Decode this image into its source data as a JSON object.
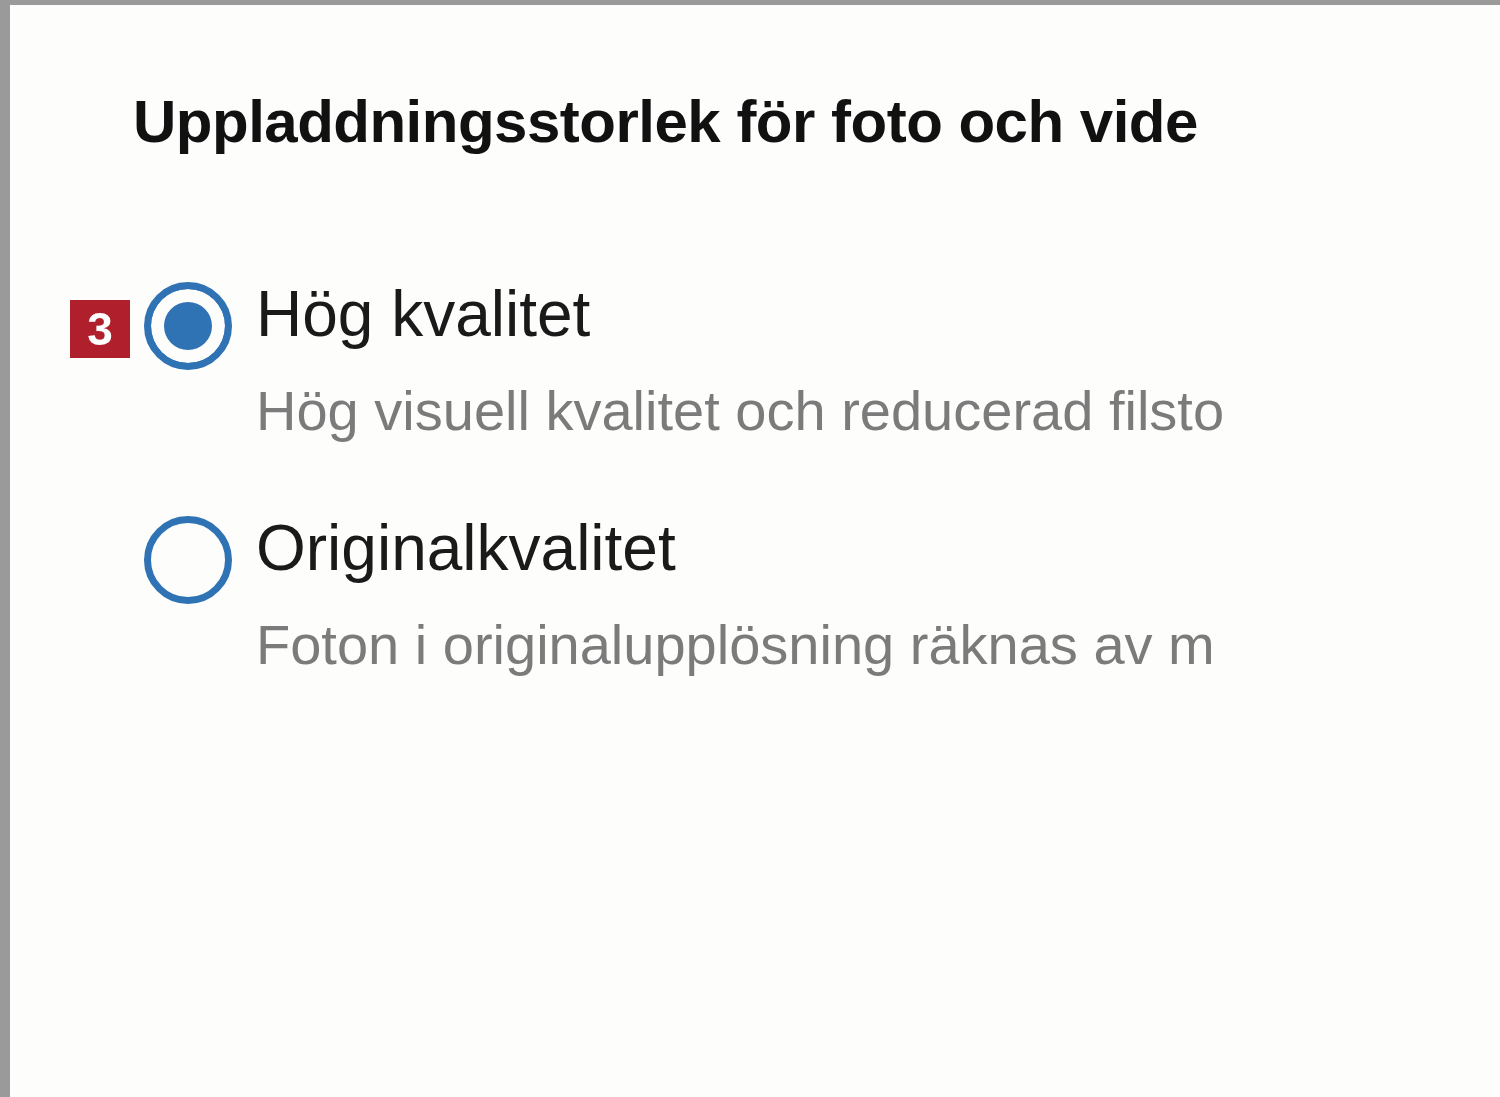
{
  "title": "Uppladdningsstorlek för foto och vide",
  "options": [
    {
      "label": "Hög kvalitet",
      "description": "Hög visuell kvalitet och reducerad filsto",
      "selected": true,
      "marker": "3"
    },
    {
      "label": "Originalkvalitet",
      "description": "Foton i originalupplösning räknas av m",
      "selected": false
    }
  ]
}
